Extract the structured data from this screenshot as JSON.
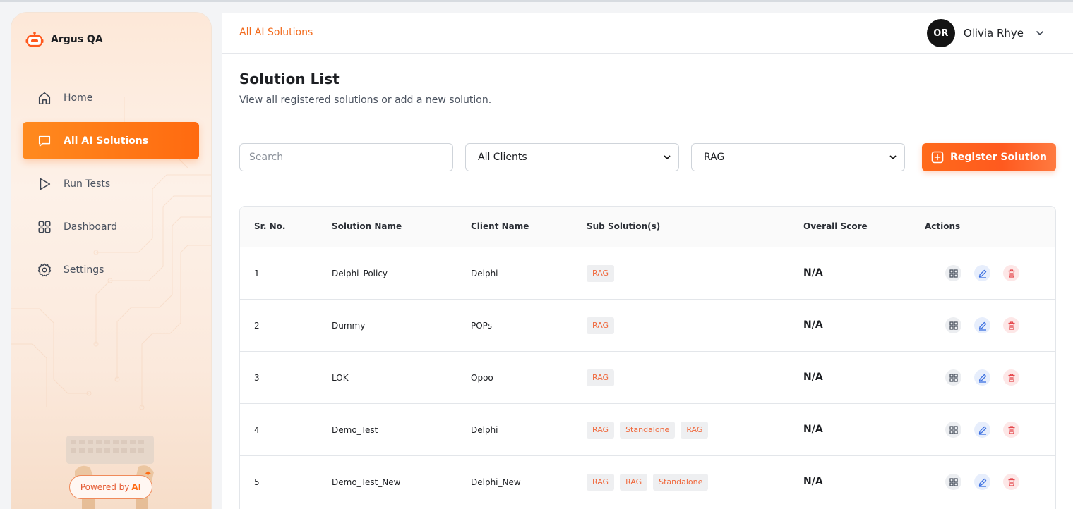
{
  "app": {
    "name": "Argus QA"
  },
  "sidebar": {
    "items": [
      {
        "label": "Home",
        "icon": "home-icon",
        "active": false
      },
      {
        "label": "All AI Solutions",
        "icon": "chat-icon",
        "active": true
      },
      {
        "label": "Run Tests",
        "icon": "play-icon",
        "active": false
      },
      {
        "label": "Dashboard",
        "icon": "grid-icon",
        "active": false
      },
      {
        "label": "Settings",
        "icon": "gear-icon",
        "active": false
      }
    ],
    "powered_prefix": "Powered by",
    "powered_ai": "AI"
  },
  "header": {
    "breadcrumb": "All AI Solutions",
    "user_initials": "OR",
    "user_name": "Olivia Rhye"
  },
  "page": {
    "title": "Solution List",
    "subtitle": "View all registered solutions or add a new solution."
  },
  "filters": {
    "search_placeholder": "Search",
    "client_selected": "All Clients",
    "type_selected": "RAG",
    "register_label": "Register Solution"
  },
  "table": {
    "headers": {
      "sr": "Sr. No.",
      "name": "Solution Name",
      "client": "Client Name",
      "sub": "Sub Solution(s)",
      "score": "Overall Score",
      "actions": "Actions"
    },
    "rows": [
      {
        "sr": "1",
        "name": "Delphi_Policy",
        "client": "Delphi",
        "tags": [
          "RAG"
        ],
        "score": "N/A"
      },
      {
        "sr": "2",
        "name": "Dummy",
        "client": "POPs",
        "tags": [
          "RAG"
        ],
        "score": "N/A"
      },
      {
        "sr": "3",
        "name": "LOK",
        "client": "Opoo",
        "tags": [
          "RAG"
        ],
        "score": "N/A"
      },
      {
        "sr": "4",
        "name": "Demo_Test",
        "client": "Delphi",
        "tags": [
          "RAG",
          "Standalone",
          "RAG"
        ],
        "score": "N/A"
      },
      {
        "sr": "5",
        "name": "Demo_Test_New",
        "client": "Delphi_New",
        "tags": [
          "RAG",
          "RAG",
          "Standalone"
        ],
        "score": "N/A"
      }
    ]
  },
  "colors": {
    "accent": "#ff6a10",
    "breadcrumb": "#f26a1c",
    "tag_text": "#f0683c",
    "edit": "#3b6fe0",
    "delete": "#e5484d"
  }
}
